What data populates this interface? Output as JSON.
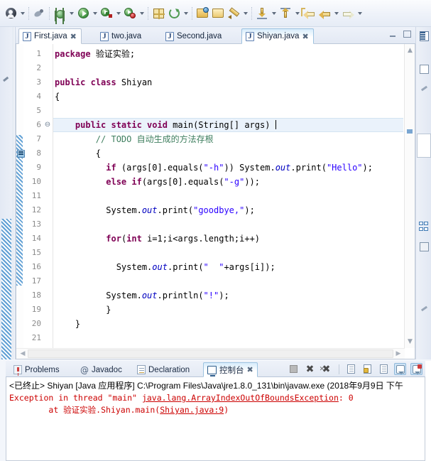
{
  "toolbar": {
    "items": [
      {
        "name": "user-account-icon",
        "glyph": "person",
        "dropdown": true
      },
      {
        "name": "skip-breakpoints-icon",
        "glyph": "bug-disabled",
        "dropdown": false
      },
      {
        "name": "debug-icon",
        "glyph": "bug",
        "dropdown": true
      },
      {
        "name": "run-icon",
        "glyph": "run",
        "dropdown": true
      },
      {
        "name": "run-configurations-icon",
        "glyph": "run-config",
        "dropdown": true
      },
      {
        "name": "run-coverage-icon",
        "glyph": "run-coverage",
        "dropdown": true
      },
      {
        "name": "new-java-package-icon",
        "glyph": "package-new",
        "dropdown": false
      },
      {
        "name": "external-tools-icon",
        "glyph": "refresh",
        "dropdown": true
      },
      {
        "name": "open-type-icon",
        "glyph": "open-folder-blue",
        "dropdown": false
      },
      {
        "name": "open-task-icon",
        "glyph": "folder-yellow",
        "dropdown": false
      },
      {
        "name": "new-task-icon",
        "glyph": "pencil",
        "dropdown": true
      },
      {
        "name": "next-annotation-icon",
        "glyph": "arrow-down",
        "dropdown": true
      },
      {
        "name": "previous-annotation-icon",
        "glyph": "arrow-up",
        "dropdown": true
      },
      {
        "name": "back-to-icon",
        "glyph": "back-double",
        "dropdown": false
      },
      {
        "name": "navigate-back-icon",
        "glyph": "back",
        "dropdown": true
      },
      {
        "name": "navigate-forward-icon",
        "glyph": "forward",
        "dropdown": true
      }
    ]
  },
  "editor": {
    "tabs": [
      {
        "label": "First.java",
        "icon": "java-file-icon",
        "active": false,
        "closable": true
      },
      {
        "label": "two.java",
        "icon": "java-file-icon",
        "active": false,
        "closable": false
      },
      {
        "label": "Second.java",
        "icon": "java-file-icon",
        "active": false,
        "closable": false
      },
      {
        "label": "Shiyan.java",
        "icon": "java-file-icon",
        "active": true,
        "closable": true
      }
    ],
    "minimize_label": "Minimize",
    "maximize_label": "Maximize",
    "line_numbers": [
      "1",
      "2",
      "3",
      "4",
      "5",
      "6",
      "7",
      "8",
      "9",
      "10",
      "11",
      "12",
      "13",
      "14",
      "15",
      "16",
      "17",
      "18",
      "19",
      "20",
      "21"
    ],
    "fold_markers": {
      "6": "⊖"
    },
    "cursor_line": 6,
    "code_lines": [
      {
        "n": 1,
        "tokens": [
          {
            "t": "kw",
            "v": "package"
          },
          {
            "t": "plain",
            "v": " "
          },
          {
            "t": "cjk",
            "v": "验证实验"
          },
          {
            "t": "plain",
            "v": ";"
          }
        ]
      },
      {
        "n": 2,
        "tokens": []
      },
      {
        "n": 3,
        "tokens": [
          {
            "t": "kw",
            "v": "public class"
          },
          {
            "t": "plain",
            "v": " Shiyan"
          }
        ]
      },
      {
        "n": 4,
        "tokens": [
          {
            "t": "plain",
            "v": "{"
          }
        ]
      },
      {
        "n": 5,
        "tokens": []
      },
      {
        "n": 6,
        "tokens": [
          {
            "t": "plain",
            "v": "    "
          },
          {
            "t": "kw",
            "v": "public static void"
          },
          {
            "t": "plain",
            "v": " main(String[] args) "
          },
          {
            "t": "caret",
            "v": ""
          }
        ]
      },
      {
        "n": 7,
        "tokens": [
          {
            "t": "plain",
            "v": "        "
          },
          {
            "t": "cmt",
            "v": "// TODO "
          },
          {
            "t": "cmt-cjk",
            "v": "自动生成的方法存根"
          }
        ]
      },
      {
        "n": 8,
        "tokens": [
          {
            "t": "plain",
            "v": "        {"
          }
        ]
      },
      {
        "n": 9,
        "tokens": [
          {
            "t": "plain",
            "v": "          "
          },
          {
            "t": "kw",
            "v": "if"
          },
          {
            "t": "plain",
            "v": " (args[0].equals("
          },
          {
            "t": "str",
            "v": "\"-h\""
          },
          {
            "t": "plain",
            "v": ")) System."
          },
          {
            "t": "stat",
            "v": "out"
          },
          {
            "t": "plain",
            "v": ".print("
          },
          {
            "t": "str",
            "v": "\"Hello\""
          },
          {
            "t": "plain",
            "v": ");"
          }
        ]
      },
      {
        "n": 10,
        "tokens": [
          {
            "t": "plain",
            "v": "          "
          },
          {
            "t": "kw",
            "v": "else if"
          },
          {
            "t": "plain",
            "v": "(args[0].equals("
          },
          {
            "t": "str",
            "v": "\"-g\""
          },
          {
            "t": "plain",
            "v": "));"
          }
        ]
      },
      {
        "n": 11,
        "tokens": []
      },
      {
        "n": 12,
        "tokens": [
          {
            "t": "plain",
            "v": "          System."
          },
          {
            "t": "stat",
            "v": "out"
          },
          {
            "t": "plain",
            "v": ".print("
          },
          {
            "t": "str",
            "v": "\"goodbye,\""
          },
          {
            "t": "plain",
            "v": ");"
          }
        ]
      },
      {
        "n": 13,
        "tokens": []
      },
      {
        "n": 14,
        "tokens": [
          {
            "t": "plain",
            "v": "          "
          },
          {
            "t": "kw",
            "v": "for"
          },
          {
            "t": "plain",
            "v": "("
          },
          {
            "t": "kw",
            "v": "int"
          },
          {
            "t": "plain",
            "v": " i=1;i<args.length;i++)"
          }
        ]
      },
      {
        "n": 15,
        "tokens": []
      },
      {
        "n": 16,
        "tokens": [
          {
            "t": "plain",
            "v": "            System."
          },
          {
            "t": "stat",
            "v": "out"
          },
          {
            "t": "plain",
            "v": ".print("
          },
          {
            "t": "str",
            "v": "\"  \""
          },
          {
            "t": "plain",
            "v": "+args[i]);"
          }
        ]
      },
      {
        "n": 17,
        "tokens": []
      },
      {
        "n": 18,
        "tokens": [
          {
            "t": "plain",
            "v": "          System."
          },
          {
            "t": "stat",
            "v": "out"
          },
          {
            "t": "plain",
            "v": ".println("
          },
          {
            "t": "str",
            "v": "\"!\""
          },
          {
            "t": "plain",
            "v": ");"
          }
        ]
      },
      {
        "n": 19,
        "tokens": [
          {
            "t": "plain",
            "v": "          }"
          }
        ]
      },
      {
        "n": 20,
        "tokens": [
          {
            "t": "plain",
            "v": "    }"
          }
        ]
      },
      {
        "n": 21,
        "tokens": []
      }
    ]
  },
  "bottom_panel": {
    "tabs": [
      {
        "label": "Problems",
        "icon": "problems-icon",
        "selected": false,
        "closable": false
      },
      {
        "label": "Javadoc",
        "icon": "javadoc-at-icon",
        "selected": false,
        "closable": false
      },
      {
        "label": "Declaration",
        "icon": "declaration-icon",
        "selected": false,
        "closable": false
      },
      {
        "label": "控制台",
        "icon": "console-icon",
        "selected": true,
        "closable": true
      }
    ],
    "tools": [
      {
        "name": "terminate-button",
        "glyph": "stop",
        "active": false
      },
      {
        "name": "remove-launch-button",
        "glyph": "x",
        "active": false
      },
      {
        "name": "remove-all-terminated-button",
        "glyph": "xx",
        "active": false
      },
      {
        "name": "clear-console-button",
        "glyph": "clear-doc",
        "active": false
      },
      {
        "name": "scroll-lock-button",
        "glyph": "lock-doc",
        "active": false
      },
      {
        "name": "word-wrap-button",
        "glyph": "wrap-doc",
        "active": false
      },
      {
        "name": "pin-console-button",
        "glyph": "pin",
        "active": true
      },
      {
        "name": "display-selected-console-button",
        "glyph": "pin-red",
        "active": true
      }
    ],
    "console_output": {
      "header": "<已终止> Shiyan [Java 应用程序] C:\\Program Files\\Java\\jre1.8.0_131\\bin\\javaw.exe  (2018年9月9日 下午",
      "lines": [
        {
          "segments": [
            {
              "t": "plain",
              "v": "Exception in thread "
            },
            {
              "t": "plain",
              "v": "\"main\" "
            },
            {
              "t": "link",
              "v": "java.lang.ArrayIndexOutOfBoundsException"
            },
            {
              "t": "plain",
              "v": ": 0"
            }
          ]
        },
        {
          "segments": [
            {
              "t": "plain",
              "v": "\tat "
            },
            {
              "t": "cjk",
              "v": "验证实验"
            },
            {
              "t": "plain",
              "v": ".Shiyan.main("
            },
            {
              "t": "link",
              "v": "Shiyan.java:9"
            },
            {
              "t": "plain",
              "v": ")"
            }
          ]
        }
      ]
    }
  },
  "right_fast_view": {
    "items": [
      {
        "name": "outline-view-icon",
        "glyph": "outline"
      },
      {
        "name": "package-explorer-icon",
        "glyph": "package"
      },
      {
        "name": "edit-view-icon",
        "glyph": "pen"
      },
      {
        "name": "type-hierarchy-icon",
        "glyph": "hierarchy"
      },
      {
        "name": "properties-view-icon",
        "glyph": "props"
      },
      {
        "name": "annotation-view-icon",
        "glyph": "pen2"
      }
    ]
  },
  "colors": {
    "keyword": "#7f0055",
    "string": "#2a00ff",
    "comment": "#3f7f5f",
    "static_field": "#0000c0",
    "console_error": "#cc0000",
    "accent_blue": "#5f9fd4",
    "tab_active_bg": "#ffffff"
  }
}
